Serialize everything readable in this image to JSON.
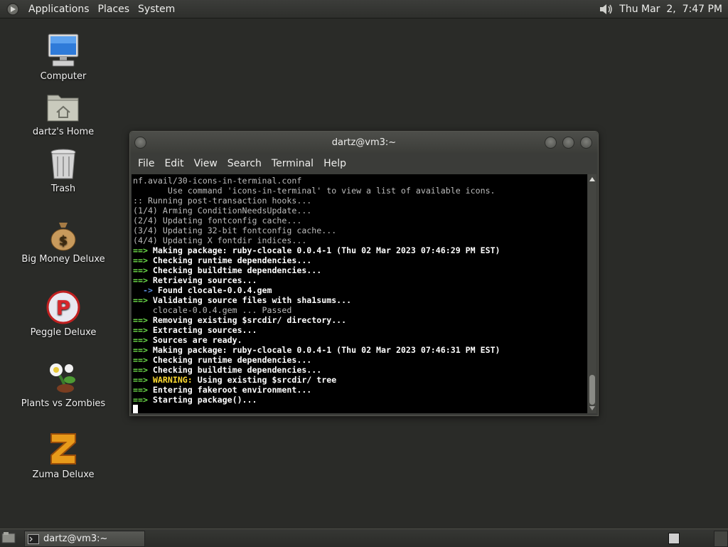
{
  "top_panel": {
    "menus": [
      "Applications",
      "Places",
      "System"
    ],
    "clock": "Thu Mar  2,  7:47 PM"
  },
  "desktop": {
    "icons": [
      {
        "label": "Computer",
        "icon": "computer-icon"
      },
      {
        "label": "dartz's Home",
        "icon": "home-folder-icon"
      },
      {
        "label": "Trash",
        "icon": "trash-icon"
      },
      {
        "label": "Big Money Deluxe",
        "icon": "money-bag-icon"
      },
      {
        "label": "Peggle Deluxe",
        "icon": "peggle-icon"
      },
      {
        "label": "Plants vs Zombies",
        "icon": "plants-icon"
      },
      {
        "label": "Zuma Deluxe",
        "icon": "zuma-icon"
      }
    ]
  },
  "terminal": {
    "title": "dartz@vm3:~",
    "menu": [
      "File",
      "Edit",
      "View",
      "Search",
      "Terminal",
      "Help"
    ],
    "lines": [
      {
        "type": "plain",
        "text": "nf.avail/30-icons-in-terminal.conf"
      },
      {
        "type": "plain",
        "text": "       Use command 'icons-in-terminal' to view a list of available icons."
      },
      {
        "type": "plain",
        "text": ":: Running post-transaction hooks..."
      },
      {
        "type": "plain",
        "text": "(1/4) Arming ConditionNeedsUpdate..."
      },
      {
        "type": "plain",
        "text": "(2/4) Updating fontconfig cache..."
      },
      {
        "type": "plain",
        "text": "(3/4) Updating 32-bit fontconfig cache..."
      },
      {
        "type": "plain",
        "text": "(4/4) Updating X fontdir indices..."
      },
      {
        "type": "arrow",
        "prefix": "==> ",
        "text": "Making package: ruby-clocale 0.0.4-1 (Thu 02 Mar 2023 07:46:29 PM EST)"
      },
      {
        "type": "arrow",
        "prefix": "==> ",
        "text": "Checking runtime dependencies..."
      },
      {
        "type": "arrow",
        "prefix": "==> ",
        "text": "Checking buildtime dependencies..."
      },
      {
        "type": "arrow",
        "prefix": "==> ",
        "text": "Retrieving sources..."
      },
      {
        "type": "sub",
        "prefix": "  -> ",
        "text": "Found clocale-0.0.4.gem"
      },
      {
        "type": "arrow",
        "prefix": "==> ",
        "text": "Validating source files with sha1sums..."
      },
      {
        "type": "plain",
        "text": "    clocale-0.0.4.gem ... Passed"
      },
      {
        "type": "arrow",
        "prefix": "==> ",
        "text": "Removing existing $srcdir/ directory..."
      },
      {
        "type": "arrow",
        "prefix": "==> ",
        "text": "Extracting sources..."
      },
      {
        "type": "arrow",
        "prefix": "==> ",
        "text": "Sources are ready."
      },
      {
        "type": "arrow",
        "prefix": "==> ",
        "text": "Making package: ruby-clocale 0.0.4-1 (Thu 02 Mar 2023 07:46:31 PM EST)"
      },
      {
        "type": "arrow",
        "prefix": "==> ",
        "text": "Checking runtime dependencies..."
      },
      {
        "type": "arrow",
        "prefix": "==> ",
        "text": "Checking buildtime dependencies..."
      },
      {
        "type": "warn",
        "prefix": "==> ",
        "label": "WARNING:",
        "text": " Using existing $srcdir/ tree"
      },
      {
        "type": "arrow",
        "prefix": "==> ",
        "text": "Entering fakeroot environment..."
      },
      {
        "type": "arrow",
        "prefix": "==> ",
        "text": "Starting package()..."
      }
    ]
  },
  "taskbar": {
    "task_label": "dartz@vm3:~"
  }
}
